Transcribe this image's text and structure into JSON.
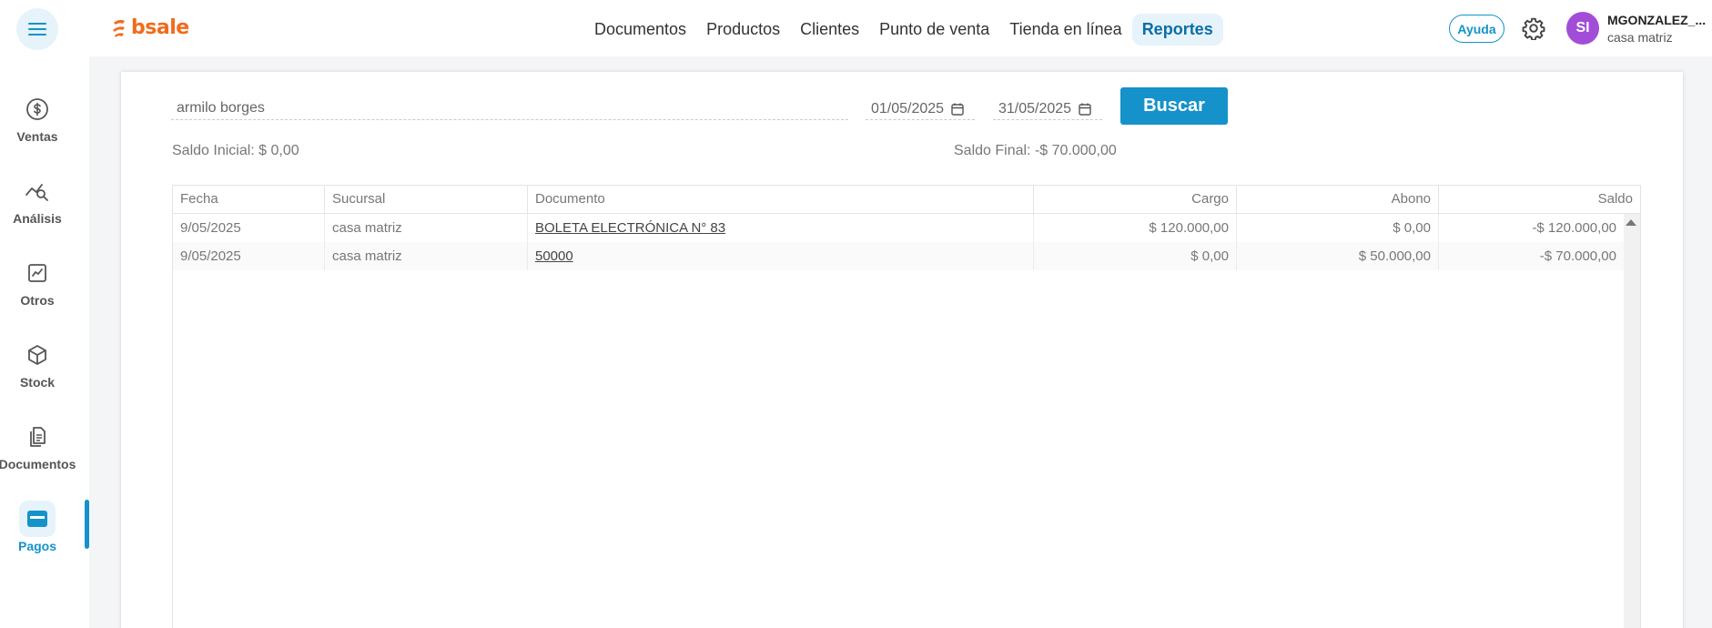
{
  "header": {
    "logo_text": "bsale",
    "nav": [
      "Documentos",
      "Productos",
      "Clientes",
      "Punto de venta",
      "Tienda en línea",
      "Reportes"
    ],
    "active_nav": "Reportes",
    "help_label": "Ayuda",
    "avatar_initials": "SI",
    "user_name": "MGONZALEZ_...",
    "user_branch": "casa matriz"
  },
  "sidebar": {
    "items": [
      {
        "label": "Ventas",
        "icon": "dollar-icon"
      },
      {
        "label": "Análisis",
        "icon": "analytics-icon"
      },
      {
        "label": "Otros",
        "icon": "trend-chart-icon"
      },
      {
        "label": "Stock",
        "icon": "box-icon"
      },
      {
        "label": "Documentos",
        "icon": "documents-icon"
      },
      {
        "label": "Pagos",
        "icon": "card-icon",
        "active": true
      }
    ]
  },
  "filters": {
    "client_value": "armilo borges",
    "date_from": "01/05/2025",
    "date_to": "31/05/2025",
    "search_label": "Buscar"
  },
  "summary": {
    "saldo_inicial": "Saldo Inicial: $ 0,00",
    "saldo_final": "Saldo Final: -$ 70.000,00"
  },
  "table": {
    "columns": [
      "Fecha",
      "Sucursal",
      "Documento",
      "Cargo",
      "Abono",
      "Saldo"
    ],
    "rows": [
      {
        "fecha": "9/05/2025",
        "sucursal": "casa matriz",
        "documento": "BOLETA ELECTRÓNICA N° 83",
        "cargo": "$ 120.000,00",
        "abono": "$ 0,00",
        "saldo": "-$ 120.000,00"
      },
      {
        "fecha": "9/05/2025",
        "sucursal": "casa matriz",
        "documento": "50000",
        "cargo": "$ 0,00",
        "abono": "$ 50.000,00",
        "saldo": "-$ 70.000,00"
      }
    ]
  },
  "colors": {
    "accent": "#1592c9",
    "brand": "#f26b1d",
    "avatar": "#a24dd8"
  }
}
